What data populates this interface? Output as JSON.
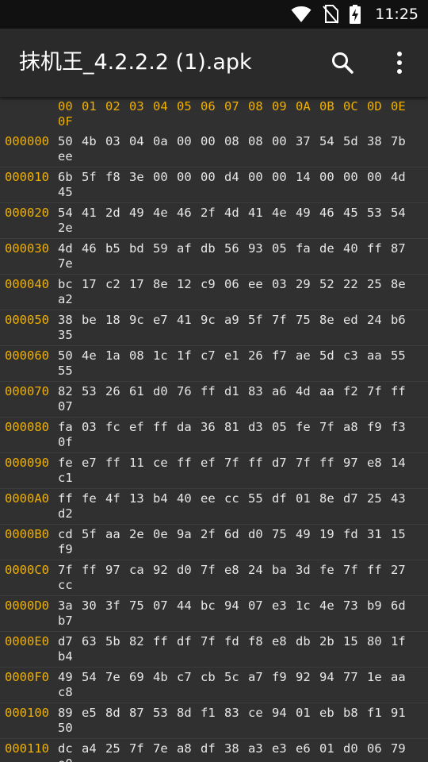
{
  "status_bar": {
    "time": "11:25",
    "icons": [
      "wifi-icon",
      "no-sim-icon",
      "battery-charging-icon"
    ]
  },
  "app_bar": {
    "title": "抹机王_4.2.2.2 (1).apk",
    "actions": [
      "search-icon",
      "more-vert-icon"
    ]
  },
  "colors": {
    "background": "#303030",
    "app_bar": "#2a2a2a",
    "status_bar": "#111111",
    "accent_offset": "#f0b000",
    "text": "#e6e6e6"
  },
  "hex_view": {
    "header": {
      "offset": "",
      "columns": [
        "00",
        "01",
        "02",
        "03",
        "04",
        "05",
        "06",
        "07",
        "08",
        "09",
        "0A",
        "0B",
        "0C",
        "0D",
        "0E"
      ],
      "last": "0F"
    },
    "rows": [
      {
        "offset": "000000",
        "bytes": [
          "50",
          "4b",
          "03",
          "04",
          "0a",
          "00",
          "00",
          "08",
          "08",
          "00",
          "37",
          "54",
          "5d",
          "38",
          "7b"
        ],
        "last": "ee"
      },
      {
        "offset": "000010",
        "bytes": [
          "6b",
          "5f",
          "f8",
          "3e",
          "00",
          "00",
          "00",
          "d4",
          "00",
          "00",
          "14",
          "00",
          "00",
          "00",
          "4d"
        ],
        "last": "45"
      },
      {
        "offset": "000020",
        "bytes": [
          "54",
          "41",
          "2d",
          "49",
          "4e",
          "46",
          "2f",
          "4d",
          "41",
          "4e",
          "49",
          "46",
          "45",
          "53",
          "54"
        ],
        "last": "2e"
      },
      {
        "offset": "000030",
        "bytes": [
          "4d",
          "46",
          "b5",
          "bd",
          "59",
          "af",
          "db",
          "56",
          "93",
          "05",
          "fa",
          "de",
          "40",
          "ff",
          "87"
        ],
        "last": "7e"
      },
      {
        "offset": "000040",
        "bytes": [
          "bc",
          "17",
          "c2",
          "17",
          "8e",
          "12",
          "c9",
          "06",
          "ee",
          "03",
          "29",
          "52",
          "22",
          "25",
          "8e"
        ],
        "last": "a2"
      },
      {
        "offset": "000050",
        "bytes": [
          "38",
          "be",
          "18",
          "9c",
          "e7",
          "41",
          "9c",
          "a9",
          "5f",
          "7f",
          "75",
          "8e",
          "ed",
          "24",
          "b6"
        ],
        "last": "35"
      },
      {
        "offset": "000060",
        "bytes": [
          "50",
          "4e",
          "1a",
          "08",
          "1c",
          "1f",
          "c7",
          "e1",
          "26",
          "f7",
          "ae",
          "5d",
          "c3",
          "aa",
          "55"
        ],
        "last": "55"
      },
      {
        "offset": "000070",
        "bytes": [
          "82",
          "53",
          "26",
          "61",
          "d0",
          "76",
          "ff",
          "d1",
          "83",
          "a6",
          "4d",
          "aa",
          "f2",
          "7f",
          "ff"
        ],
        "last": "07"
      },
      {
        "offset": "000080",
        "bytes": [
          "fa",
          "03",
          "fc",
          "ef",
          "ff",
          "da",
          "36",
          "81",
          "d3",
          "05",
          "fe",
          "7f",
          "a8",
          "f9",
          "f3"
        ],
        "last": "0f"
      },
      {
        "offset": "000090",
        "bytes": [
          "fe",
          "e7",
          "ff",
          "11",
          "ce",
          "ff",
          "ef",
          "7f",
          "ff",
          "d7",
          "7f",
          "ff",
          "97",
          "e8",
          "14"
        ],
        "last": "c1"
      },
      {
        "offset": "0000A0",
        "bytes": [
          "ff",
          "fe",
          "4f",
          "13",
          "b4",
          "40",
          "ee",
          "cc",
          "55",
          "df",
          "01",
          "8e",
          "d7",
          "25",
          "43"
        ],
        "last": "d2"
      },
      {
        "offset": "0000B0",
        "bytes": [
          "cd",
          "5f",
          "aa",
          "2e",
          "0e",
          "9a",
          "2f",
          "6d",
          "d0",
          "75",
          "49",
          "19",
          "fd",
          "31",
          "15"
        ],
        "last": "f9"
      },
      {
        "offset": "0000C0",
        "bytes": [
          "7f",
          "ff",
          "97",
          "ca",
          "92",
          "d0",
          "7f",
          "e8",
          "24",
          "ba",
          "3d",
          "fe",
          "7f",
          "ff",
          "27"
        ],
        "last": "cc"
      },
      {
        "offset": "0000D0",
        "bytes": [
          "3a",
          "30",
          "3f",
          "75",
          "07",
          "44",
          "bc",
          "94",
          "07",
          "e3",
          "1c",
          "4e",
          "73",
          "b9",
          "6d"
        ],
        "last": "b7"
      },
      {
        "offset": "0000E0",
        "bytes": [
          "d7",
          "63",
          "5b",
          "82",
          "ff",
          "df",
          "7f",
          "fd",
          "f8",
          "e8",
          "db",
          "2b",
          "15",
          "80",
          "1f"
        ],
        "last": "b4"
      },
      {
        "offset": "0000F0",
        "bytes": [
          "49",
          "54",
          "7e",
          "69",
          "4b",
          "c7",
          "cb",
          "5c",
          "a7",
          "f9",
          "92",
          "94",
          "77",
          "1e",
          "aa"
        ],
        "last": "c8"
      },
      {
        "offset": "000100",
        "bytes": [
          "89",
          "e5",
          "8d",
          "87",
          "53",
          "8d",
          "f1",
          "83",
          "ce",
          "94",
          "01",
          "eb",
          "b8",
          "f1",
          "91"
        ],
        "last": "50"
      },
      {
        "offset": "000110",
        "bytes": [
          "dc",
          "a4",
          "25",
          "7f",
          "7e",
          "a8",
          "df",
          "38",
          "a3",
          "e3",
          "e6",
          "01",
          "d0",
          "06",
          "79"
        ],
        "last": "e0"
      }
    ]
  }
}
